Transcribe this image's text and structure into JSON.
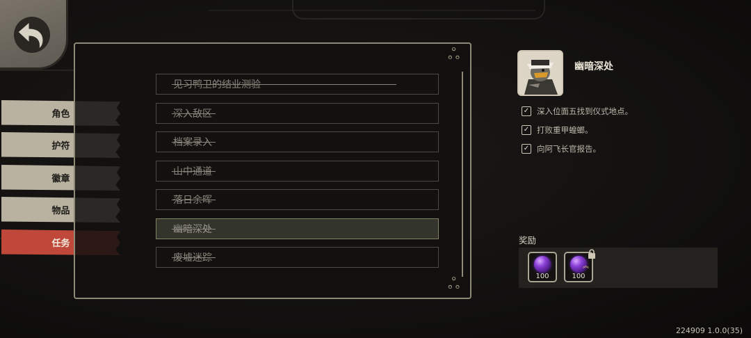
{
  "nav": {
    "tabs": [
      {
        "label": "角色",
        "active": false
      },
      {
        "label": "护符",
        "active": false
      },
      {
        "label": "徽章",
        "active": false
      },
      {
        "label": "物品",
        "active": false
      },
      {
        "label": "任务",
        "active": true
      }
    ]
  },
  "quests": [
    {
      "title": "见习鸭卫的结业测验",
      "completed": true,
      "selected": false
    },
    {
      "title": "深入敌区",
      "completed": true,
      "selected": false
    },
    {
      "title": "档案录入",
      "completed": true,
      "selected": false
    },
    {
      "title": "山中通道",
      "completed": true,
      "selected": false
    },
    {
      "title": "落日余晖",
      "completed": true,
      "selected": false
    },
    {
      "title": "幽暗深处",
      "completed": true,
      "selected": true
    },
    {
      "title": "废墟迷踪",
      "completed": true,
      "selected": false
    }
  ],
  "detail": {
    "title": "幽暗深处",
    "objectives": [
      {
        "text": "深入位面五找到仪式地点。",
        "checked": true
      },
      {
        "text": "打败重甲蝗螂。",
        "checked": true
      },
      {
        "text": "向阿飞长官报告。",
        "checked": true
      }
    ],
    "rewards_label": "奖励",
    "rewards": [
      {
        "icon": "purple-orb-icon",
        "quantity": "100",
        "locked": false
      },
      {
        "icon": "purple-orb-rank-icon",
        "quantity": "100",
        "locked": true
      }
    ]
  },
  "version": "224909 1.0.0(35)",
  "colors": {
    "active_tab": "#c0483a",
    "tab": "#b9b2a1",
    "panel_border": "#8f8977",
    "orb": "#8a3fd6"
  }
}
